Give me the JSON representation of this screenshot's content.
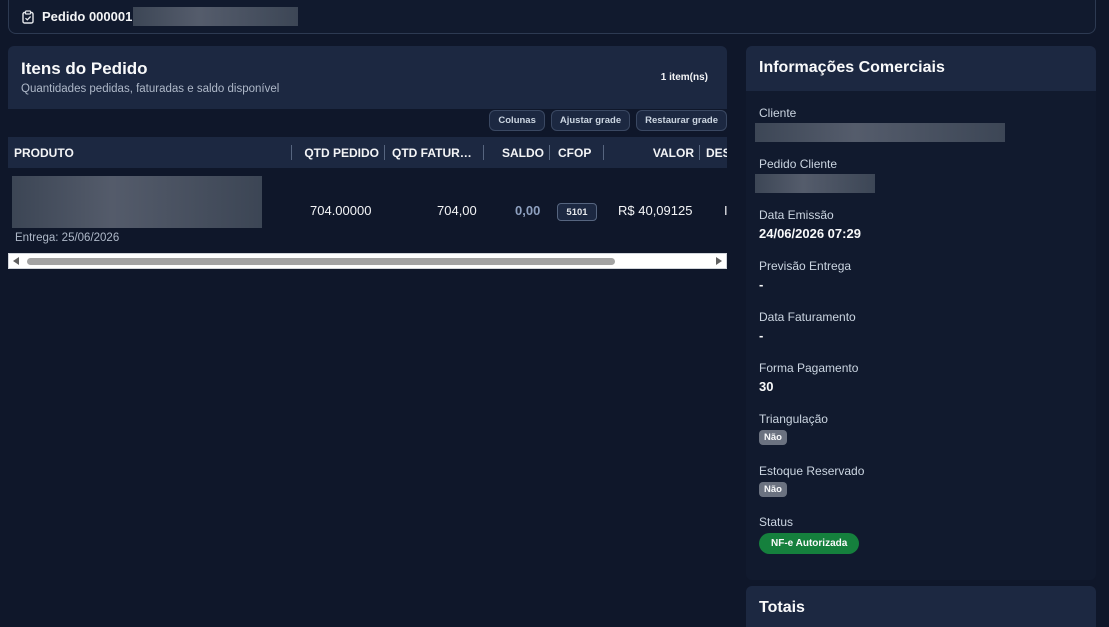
{
  "order": {
    "title": "Pedido 000001"
  },
  "items": {
    "title": "Itens do Pedido",
    "subtitle": "Quantidades pedidas, faturadas e saldo disponível",
    "count": "1 item(ns)",
    "buttons": [
      "Colunas",
      "Ajustar grade",
      "Restaurar grade"
    ],
    "columns": [
      "PRODUTO",
      "QTD PEDIDO",
      "QTD FATUR…",
      "SALDO",
      "CFOP",
      "VALOR",
      "DES"
    ],
    "rows": [
      {
        "delivery": "Entrega: 25/06/2026",
        "qtd_pedido": "704.00000",
        "qtd_faturada": "704,00",
        "saldo": "0,00",
        "cfop": "5101",
        "valor": "R$ 40,09125",
        "desc": "I"
      }
    ]
  },
  "info": {
    "title": "Informações Comerciais",
    "cliente_label": "Cliente",
    "pedido_cliente_label": "Pedido Cliente",
    "data_emissao_label": "Data Emissão",
    "data_emissao": "24/06/2026 07:29",
    "previsao_entrega_label": "Previsão Entrega",
    "previsao_entrega": "-",
    "data_faturamento_label": "Data Faturamento",
    "data_faturamento": "-",
    "forma_pagamento_label": "Forma Pagamento",
    "forma_pagamento": "30",
    "triangulacao_label": "Triangulação",
    "triangulacao": "Não",
    "estoque_reservado_label": "Estoque Reservado",
    "estoque_reservado": "Não",
    "status_label": "Status",
    "status": "NF-e Autorizada",
    "status_color": "#15803d"
  },
  "totals": {
    "title": "Totais"
  }
}
